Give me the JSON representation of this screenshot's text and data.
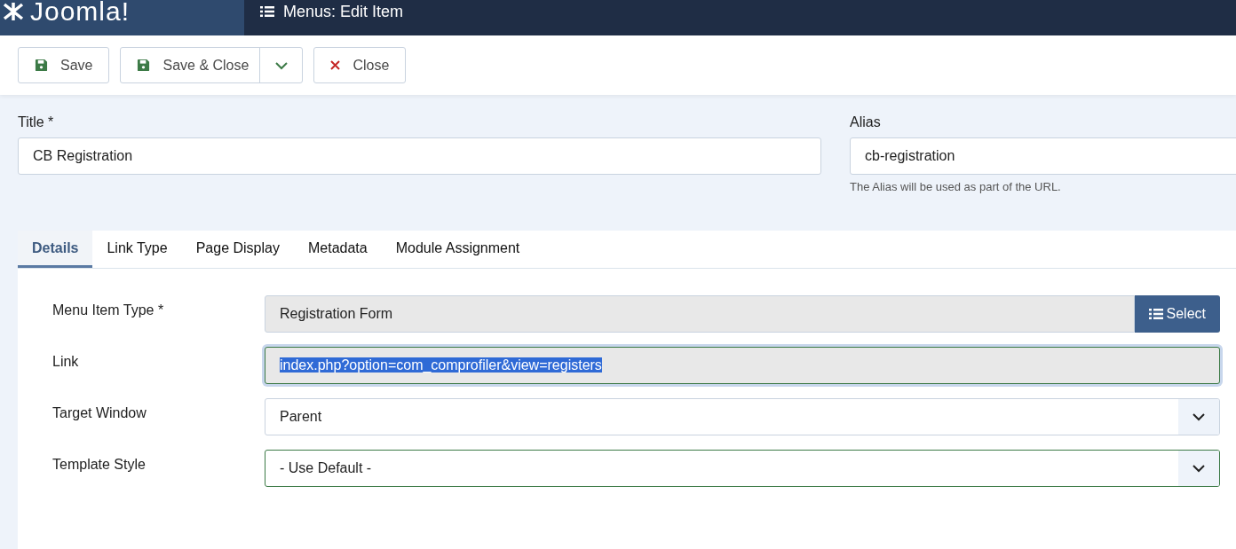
{
  "header": {
    "logo": "Joomla!",
    "title": "Menus: Edit Item"
  },
  "toolbar": [
    {
      "kind": "save",
      "label": "Save"
    },
    {
      "kind": "save-split",
      "label": "Save & Close"
    },
    {
      "kind": "close",
      "label": "Close"
    }
  ],
  "title_field": {
    "label": "Title *",
    "value": "CB Registration"
  },
  "alias_field": {
    "label": "Alias",
    "value": "cb-registration",
    "hint": "The Alias will be used as part of the URL."
  },
  "tabs": [
    {
      "label": "Details",
      "selected": true
    },
    {
      "label": "Link Type",
      "selected": false
    },
    {
      "label": "Page Display",
      "selected": false
    },
    {
      "label": "Metadata",
      "selected": false
    },
    {
      "label": "Module Assignment",
      "selected": false
    }
  ],
  "fields": [
    {
      "kind": "picker",
      "label": "Menu Item Type *",
      "value": "Registration Form",
      "button": "Select",
      "focused": false,
      "valid": false,
      "highlighted": false
    },
    {
      "kind": "readonly",
      "label": "Link",
      "value": "index.php?option=com_comprofiler&view=registers",
      "focused": true,
      "valid": true,
      "highlighted": true
    },
    {
      "kind": "select",
      "label": "Target Window",
      "value": "Parent",
      "focused": false,
      "valid": false,
      "highlighted": false
    },
    {
      "kind": "select",
      "label": "Template Style",
      "value": "- Use Default -",
      "focused": false,
      "valid": true,
      "highlighted": false
    }
  ]
}
